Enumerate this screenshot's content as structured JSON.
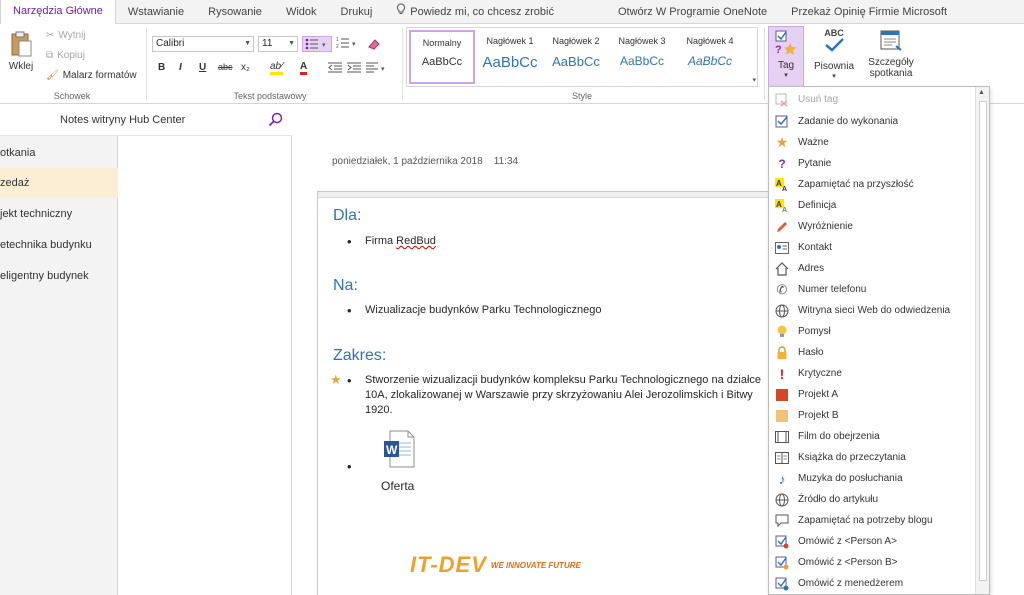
{
  "tabs": [
    {
      "label": "Narzędzia Główne",
      "active": true
    },
    {
      "label": "Wstawianie"
    },
    {
      "label": "Rysowanie"
    },
    {
      "label": "Widok"
    },
    {
      "label": "Drukuj"
    },
    {
      "label": "Powiedz mi, co chcesz zrobić",
      "icon": "lightbulb-icon"
    },
    {
      "label": "Otwórz W Programie OneNote"
    },
    {
      "label": "Przekaż Opinię Firmie Microsoft"
    }
  ],
  "clipboard": {
    "paste": "Wklej",
    "cut": "Wytnij",
    "copy": "Kopiuj",
    "format_painter": "Malarz formatów",
    "group_label": "Schowek"
  },
  "basic_text": {
    "font": "Calibri",
    "size": "11",
    "bold": "B",
    "italic": "I",
    "underline": "U",
    "strike": "abc",
    "subscript": "x₂",
    "highlight": "ab⁄",
    "font_color": "A",
    "group_label": "Tekst podstawowy"
  },
  "styles": {
    "items": [
      {
        "name": "Normalny",
        "sample": "AaBbCc"
      },
      {
        "name": "Nagłówek 1",
        "sample": "AaBbCc"
      },
      {
        "name": "Nagłówek 2",
        "sample": "AaBbCc"
      },
      {
        "name": "Nagłówek 3",
        "sample": "AaBbCc"
      },
      {
        "name": "Nagłówek 4",
        "sample": "AaBbCc"
      }
    ],
    "group_label": "Style"
  },
  "tags_group": {
    "tag": "Tag",
    "spelling": "Pisownia",
    "spelling_icon_text": "ABC",
    "meeting_line1": "Szczegóły",
    "meeting_line2": "spotkania"
  },
  "notebook": {
    "title": "Notes witryny Hub Center",
    "sections": [
      {
        "label": "otkania"
      },
      {
        "label": "zedaż",
        "active": true
      },
      {
        "label": "jekt techniczny"
      },
      {
        "label": "etechnika budynku"
      },
      {
        "label": "eligentny budynek"
      }
    ]
  },
  "page": {
    "date": "poniedziałek, 1 października 2018",
    "time": "11:34",
    "dla_heading": "Dla:",
    "dla_bullet_prefix": "Firma",
    "dla_bullet_name": "RedBud",
    "na_heading": "Na:",
    "na_bullet": "Wizualizacje budynków Parku Technologicznego",
    "zakres_heading": "Zakres:",
    "zakres_line1": "Stworzenie wizualizacji budynków kompleksu Parku Technologicznego na działce",
    "zakres_line2": "10A, zlokalizowanej w Warszawie przy skrzyżowaniu Alei Jerozolimskich i Bitwy",
    "zakres_line3": "1920.",
    "file_name": "Oferta",
    "logo_main": "IT-DEV",
    "logo_tagline": "WE INNOVATE FUTURE"
  },
  "tag_menu": {
    "items": [
      {
        "label": "Usuń tag",
        "icon": "remove-tag-icon",
        "disabled": true
      },
      {
        "label": "Zadanie do wykonania",
        "icon": "checkbox-icon"
      },
      {
        "label": "Ważne",
        "icon": "star-icon"
      },
      {
        "label": "Pytanie",
        "icon": "question-icon"
      },
      {
        "label": "Zapamiętać na przyszłość",
        "icon": "highlight-a-icon"
      },
      {
        "label": "Definicja",
        "icon": "definition-icon"
      },
      {
        "label": "Wyróżnienie",
        "icon": "highlighter-pen-icon"
      },
      {
        "label": "Kontakt",
        "icon": "contact-card-icon"
      },
      {
        "label": "Adres",
        "icon": "house-icon"
      },
      {
        "label": "Numer telefonu",
        "icon": "phone-icon"
      },
      {
        "label": "Witryna sieci Web do odwiedzenia",
        "icon": "globe-icon"
      },
      {
        "label": "Pomysł",
        "icon": "lightbulb-icon"
      },
      {
        "label": "Hasło",
        "icon": "lock-icon"
      },
      {
        "label": "Krytyczne",
        "icon": "exclamation-icon"
      },
      {
        "label": "Projekt A",
        "icon": "project-a-icon"
      },
      {
        "label": "Projekt B",
        "icon": "project-b-icon"
      },
      {
        "label": "Film do obejrzenia",
        "icon": "film-icon"
      },
      {
        "label": "Książka do przeczytania",
        "icon": "book-icon"
      },
      {
        "label": "Muzyka do posłuchania",
        "icon": "music-note-icon"
      },
      {
        "label": "Źródło do artykułu",
        "icon": "source-globe-icon"
      },
      {
        "label": "Zapamiętać na potrzeby blogu",
        "icon": "speech-bubble-icon"
      },
      {
        "label": "Omówić z <Person A>",
        "icon": "discuss-person-a-icon"
      },
      {
        "label": "Omówić z <Person B>",
        "icon": "discuss-person-b-icon"
      },
      {
        "label": "Omówić z menedżerem",
        "icon": "discuss-manager-icon"
      }
    ]
  },
  "colors": {
    "accent": "#7719aa",
    "heading_blue": "#2e74b5",
    "active_section": "#fbeed4",
    "tag_button_bg": "#e6d1f2"
  }
}
